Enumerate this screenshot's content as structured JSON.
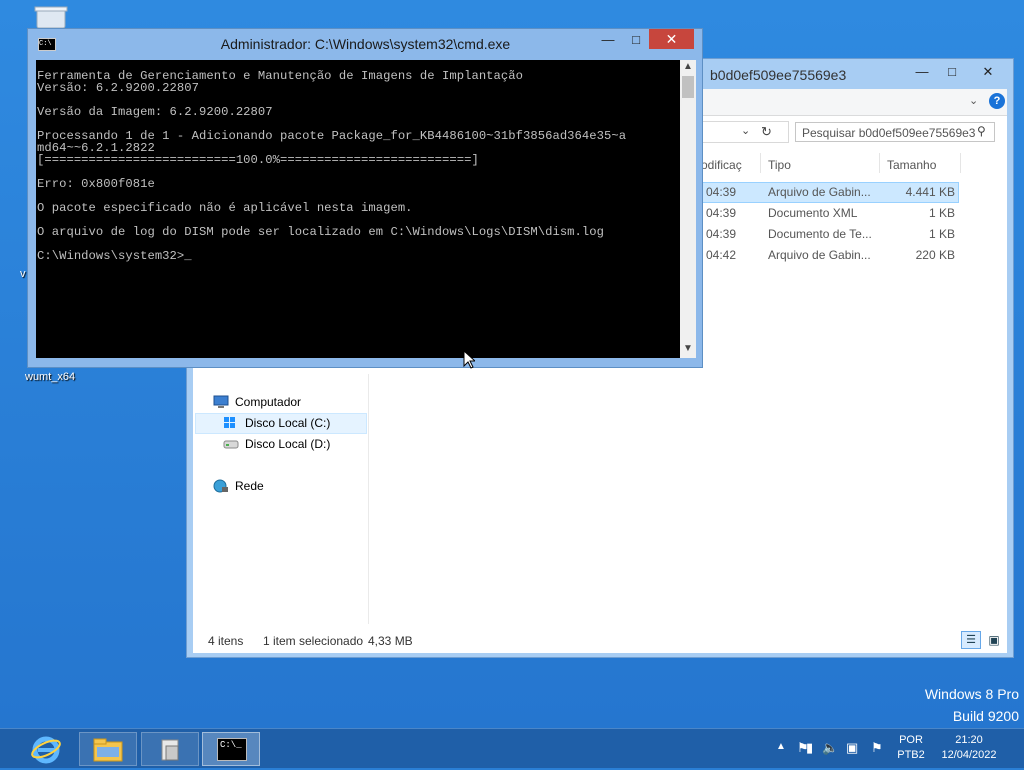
{
  "desktop": {
    "icons": [
      {
        "label": "wumt_x64"
      }
    ],
    "watermark": {
      "line1": "Windows 8 Pro",
      "line2": "Build 9200"
    }
  },
  "explorer": {
    "title": "b0d0ef509ee75569e3",
    "search_placeholder": "Pesquisar b0d0ef509ee75569e3",
    "columns": {
      "modified": "odificaç",
      "type": "Tipo",
      "size": "Tamanho"
    },
    "files": [
      {
        "time": "04:39",
        "type": "Arquivo de Gabin...",
        "size": "4.441 KB",
        "selected": true
      },
      {
        "time": "04:39",
        "type": "Documento XML",
        "size": "1 KB",
        "selected": false
      },
      {
        "time": "04:39",
        "type": "Documento de Te...",
        "size": "1 KB",
        "selected": false
      },
      {
        "time": "04:42",
        "type": "Arquivo de Gabin...",
        "size": "220 KB",
        "selected": false
      }
    ],
    "nav": {
      "computer": "Computador",
      "drive_c": "Disco Local (C:)",
      "drive_d": "Disco Local (D:)",
      "network": "Rede"
    },
    "status": {
      "count": "4 itens",
      "selection": "1 item selecionado",
      "size": "4,33 MB"
    }
  },
  "cmd": {
    "title": "Administrador: C:\\Windows\\system32\\cmd.exe",
    "lines": [
      "Ferramenta de Gerenciamento e Manutenção de Imagens de Implantação",
      "Versão: 6.2.9200.22807",
      "",
      "Versão da Imagem: 6.2.9200.22807",
      "",
      "Processando 1 de 1 - Adicionando pacote Package_for_KB4486100~31bf3856ad364e35~a",
      "md64~~6.2.1.2822",
      "[==========================100.0%==========================]",
      "",
      "Erro: 0x800f081e",
      "",
      "O pacote especificado não é aplicável nesta imagem.",
      "",
      "O arquivo de log do DISM pode ser localizado em C:\\Windows\\Logs\\DISM\\dism.log",
      "",
      "C:\\Windows\\system32>_"
    ]
  },
  "taskbar": {
    "language": "POR",
    "layout": "PTB2",
    "time": "21:20",
    "date": "12/04/2022"
  }
}
